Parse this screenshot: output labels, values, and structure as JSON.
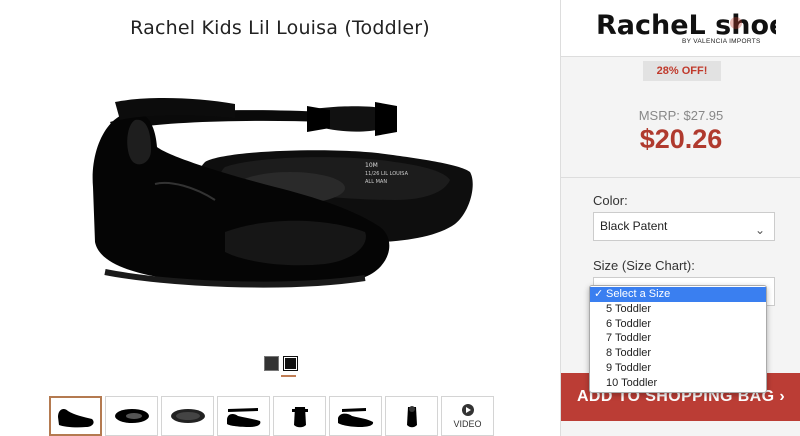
{
  "product": {
    "title": "Rachel Kids Lil Louisa (Toddler)",
    "label_size": "10M",
    "label_line2": "11/26 LIL LOUISA",
    "label_line3": "ALL MAN"
  },
  "gallery": {
    "swatch_count": 2,
    "thumbnails": [
      {
        "name": "side-view",
        "selected": true
      },
      {
        "name": "top-view",
        "selected": false
      },
      {
        "name": "sole-view",
        "selected": false
      },
      {
        "name": "side-strap",
        "selected": false
      },
      {
        "name": "back-view",
        "selected": false
      },
      {
        "name": "angle-view",
        "selected": false
      },
      {
        "name": "pair-view",
        "selected": false
      },
      {
        "name": "video",
        "selected": false
      }
    ],
    "video_label": "VIDEO"
  },
  "brand": {
    "logo_text": "RacheL shoes",
    "sub": "BY VALENCIA IMPORTS"
  },
  "pricing": {
    "discount": "28% OFF!",
    "msrp": "MSRP: $27.95",
    "price": "$20.26"
  },
  "options": {
    "color_label": "Color:",
    "color_value": "Black Patent",
    "size_label": "Size (Size Chart):",
    "size_options": [
      "Select a Size",
      "5 Toddler",
      "6 Toddler",
      "7 Toddler",
      "8 Toddler",
      "9 Toddler",
      "10 Toddler"
    ],
    "selected_index": 0
  },
  "cta": {
    "add_to_bag": "ADD TO SHOPPING BAG ›"
  },
  "colors": {
    "price_red": "#b03a2e",
    "cta_red": "#bb3d35",
    "accent_bronze": "#b47a50",
    "select_blue": "#3a7ff0"
  }
}
